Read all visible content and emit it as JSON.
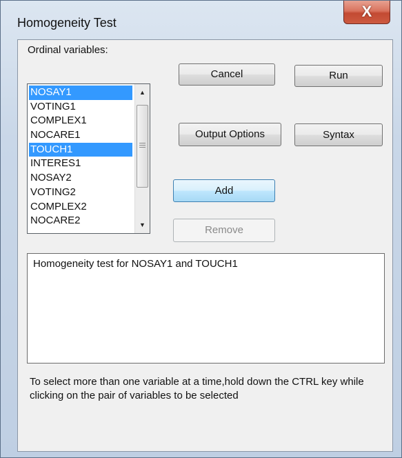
{
  "window": {
    "title": "Homogeneity Test",
    "close_glyph": "X"
  },
  "ordinal": {
    "label": "Ordinal variables:",
    "items": [
      {
        "label": "NOSAY1",
        "selected": true
      },
      {
        "label": "VOTING1",
        "selected": false
      },
      {
        "label": "COMPLEX1",
        "selected": false
      },
      {
        "label": "NOCARE1",
        "selected": false
      },
      {
        "label": "TOUCH1",
        "selected": true
      },
      {
        "label": "INTERES1",
        "selected": false
      },
      {
        "label": "NOSAY2",
        "selected": false
      },
      {
        "label": "VOTING2",
        "selected": false
      },
      {
        "label": "COMPLEX2",
        "selected": false
      },
      {
        "label": "NOCARE2",
        "selected": false
      }
    ]
  },
  "buttons": {
    "cancel": "Cancel",
    "run": "Run",
    "output_options": "Output Options",
    "syntax": "Syntax",
    "add": "Add",
    "remove": "Remove"
  },
  "output": {
    "text": "Homogeneity test for NOSAY1 and TOUCH1"
  },
  "instructions": "To select more than one variable at a time,hold down the CTRL key while clicking on the pair of variables to be selected",
  "icons": {
    "scroll_up": "scroll-up-arrow-icon",
    "scroll_down": "scroll-down-arrow-icon"
  },
  "colors": {
    "selection": "#3399ff",
    "close_button": "#c94b33"
  }
}
